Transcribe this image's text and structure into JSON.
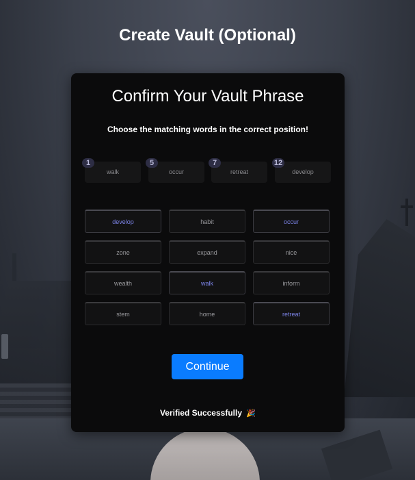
{
  "page": {
    "title": "Create Vault (Optional)"
  },
  "card": {
    "title": "Confirm Your Vault Phrase",
    "instructions": "Choose the matching words in the correct position!",
    "slots": [
      {
        "number": "1",
        "word": "walk"
      },
      {
        "number": "5",
        "word": "occur"
      },
      {
        "number": "7",
        "word": "retreat"
      },
      {
        "number": "12",
        "word": "develop"
      }
    ],
    "words": [
      {
        "label": "develop",
        "selected": true
      },
      {
        "label": "habit",
        "selected": false
      },
      {
        "label": "occur",
        "selected": true
      },
      {
        "label": "zone",
        "selected": false
      },
      {
        "label": "expand",
        "selected": false
      },
      {
        "label": "nice",
        "selected": false
      },
      {
        "label": "wealth",
        "selected": false
      },
      {
        "label": "walk",
        "selected": true
      },
      {
        "label": "inform",
        "selected": false
      },
      {
        "label": "stem",
        "selected": false
      },
      {
        "label": "home",
        "selected": false
      },
      {
        "label": "retreat",
        "selected": true
      }
    ],
    "continue_label": "Continue",
    "status_text": "Verified Successfully",
    "status_icon": "🎉"
  },
  "colors": {
    "accent": "#0a7cff",
    "selected_word": "#7b83e6",
    "card_bg": "#0b0b0c"
  }
}
